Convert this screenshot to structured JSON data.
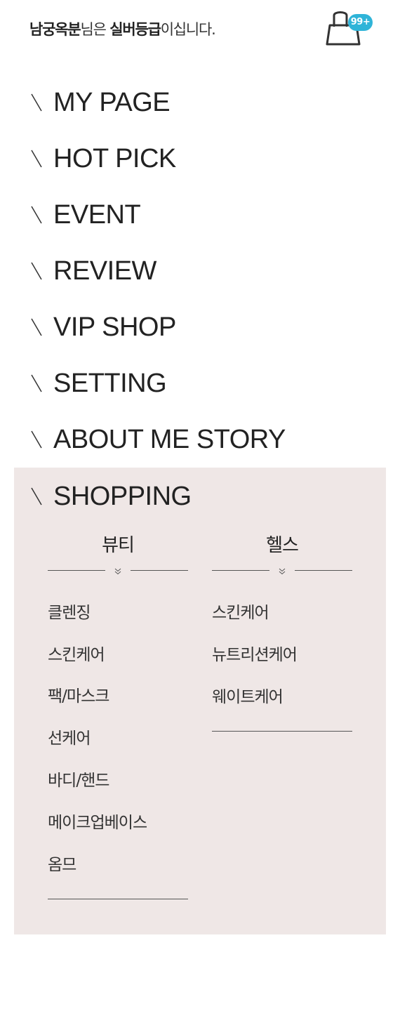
{
  "header": {
    "user_name": "남궁옥분",
    "text_1": "님은 ",
    "grade": "실버등급",
    "text_2": "이십니다."
  },
  "cart": {
    "icon": "shopping-bag-icon",
    "badge": "99+",
    "badge_color": "#2fb4d8"
  },
  "menu": {
    "items": [
      {
        "label": "MY PAGE"
      },
      {
        "label": "HOT PICK"
      },
      {
        "label": "EVENT"
      },
      {
        "label": "REVIEW"
      },
      {
        "label": "VIP SHOP"
      },
      {
        "label": "SETTING"
      },
      {
        "label": "ABOUT ME STORY"
      },
      {
        "label": "SHOPPING"
      }
    ]
  },
  "shopping": {
    "panel_color": "#efe7e6",
    "beauty": {
      "title": "뷰티",
      "items": [
        "클렌징",
        "스킨케어",
        "팩/마스크",
        "선케어",
        "바디/핸드",
        "메이크업베이스",
        "옴므"
      ]
    },
    "health": {
      "title": "헬스",
      "items": [
        "스킨케어",
        "뉴트리션케어",
        "웨이트케어"
      ]
    }
  }
}
